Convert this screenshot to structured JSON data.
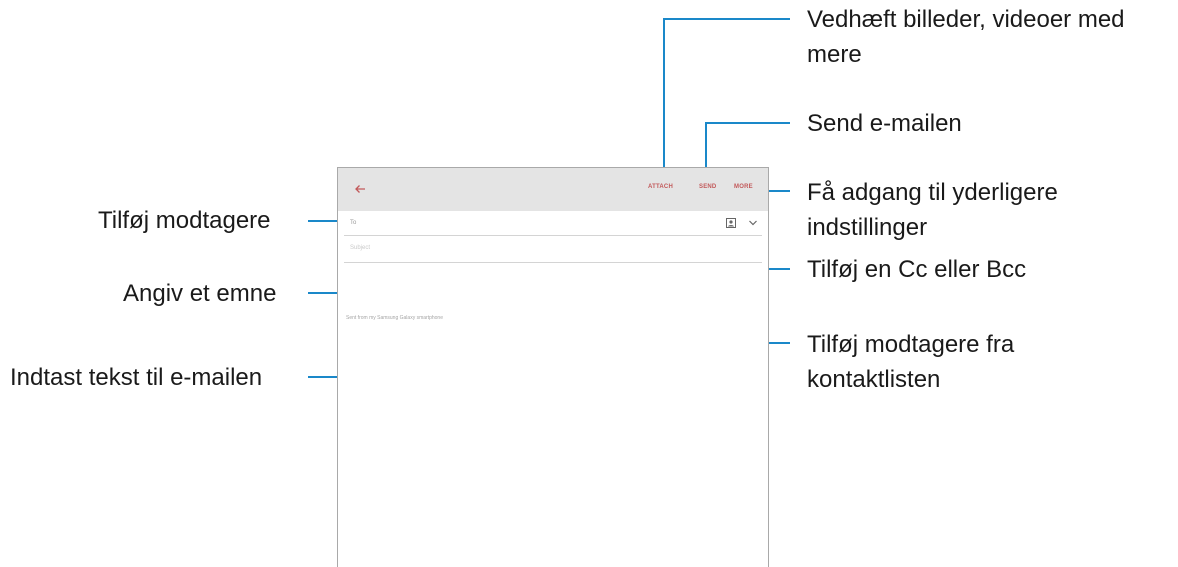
{
  "email_app": {
    "actions": {
      "attach": "ATTACH",
      "send": "SEND",
      "more": "MORE"
    },
    "to_label": "To",
    "subject_placeholder": "Subject",
    "signature": "Sent from my Samsung Galaxy smartphone",
    "accent_color": "#c2595a"
  },
  "callouts": {
    "attach": "Vedhæft billeder, videoer med mere",
    "send": "Send e-mailen",
    "more": "Få adgang til yderligere indstillinger",
    "cc_bcc": "Tilføj en Cc eller Bcc",
    "contacts": "Tilføj modtagere fra kontaktlisten",
    "recipients": "Tilføj modtagere",
    "subject": "Angiv et emne",
    "body": "Indtast tekst til e-mailen"
  },
  "icons": {
    "back": "back-arrow-icon",
    "contact": "contact-card-icon",
    "expand": "chevron-down-icon"
  }
}
